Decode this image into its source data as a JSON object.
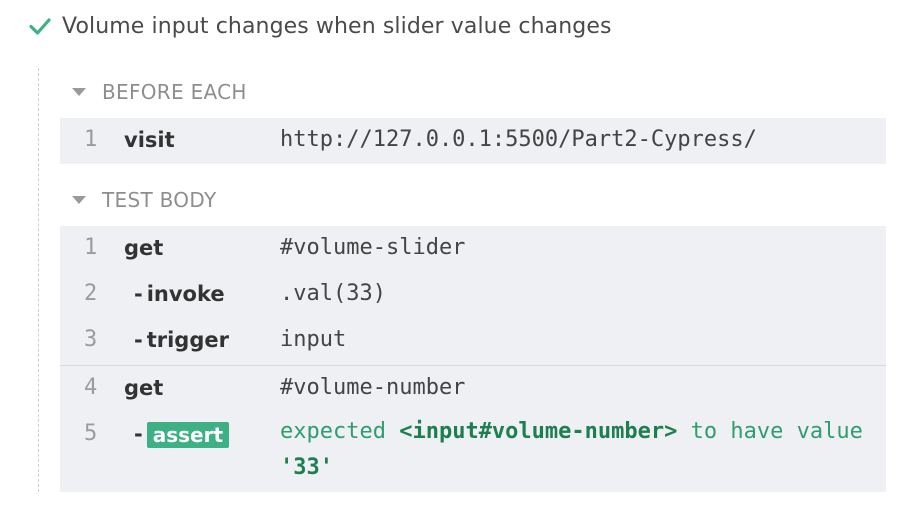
{
  "test": {
    "title": "Volume input changes when slider value changes",
    "status_icon": "check-icon"
  },
  "sections": {
    "before_each": {
      "label": "BEFORE EACH",
      "commands": [
        {
          "num": "1",
          "method": "visit",
          "message": "http://127.0.0.1:5500/Part2-Cypress/"
        }
      ]
    },
    "test_body": {
      "label": "TEST BODY",
      "commands": [
        {
          "num": "1",
          "method": "get",
          "message": "#volume-slider"
        },
        {
          "num": "2",
          "dash": "-",
          "method": "invoke",
          "message": ".val(33)"
        },
        {
          "num": "3",
          "dash": "-",
          "method": "trigger",
          "message": "input"
        },
        {
          "num": "4",
          "method": "get",
          "message": "#volume-number"
        },
        {
          "num": "5",
          "dash": "-",
          "method": "assert",
          "message_parts": {
            "expected": "expected",
            "subject": "<input#volume-number>",
            "to_have": "to have",
            "value_word": "value",
            "value": "'33'"
          }
        }
      ]
    }
  },
  "colors": {
    "pass_green": "#3eb085",
    "block_bg": "#eef0f3"
  }
}
